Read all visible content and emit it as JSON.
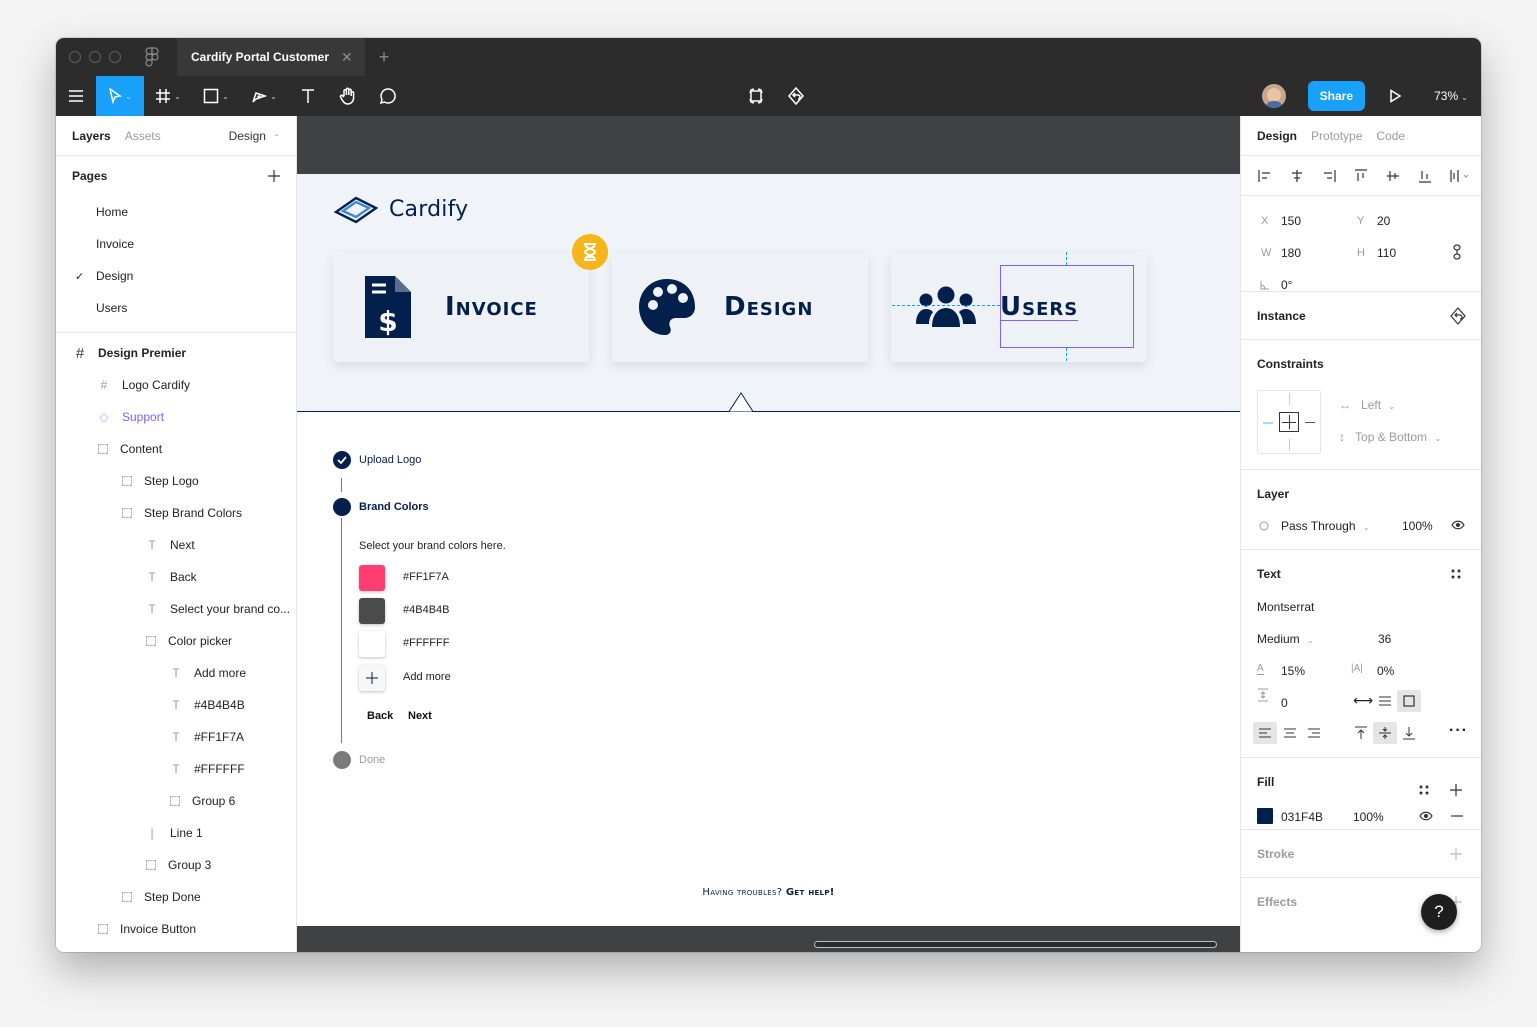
{
  "window": {
    "doc_title": "Cardify Portal Customer",
    "zoom": "73%",
    "share_label": "Share"
  },
  "left_panel": {
    "tabs": {
      "layers": "Layers",
      "assets": "Assets",
      "page_selector": "Design"
    },
    "pages_title": "Pages",
    "pages": [
      {
        "label": "Home",
        "checked": false
      },
      {
        "label": "Invoice",
        "checked": false
      },
      {
        "label": "Design",
        "checked": true
      },
      {
        "label": "Users",
        "checked": false
      }
    ],
    "layers": [
      {
        "label": "Design Premier",
        "indent": 0,
        "icon": "frame-icon",
        "bold": true
      },
      {
        "label": "Logo Cardify",
        "indent": 1,
        "icon": "frame-icon"
      },
      {
        "label": "Support",
        "indent": 1,
        "icon": "component-instance-icon",
        "purple": true
      },
      {
        "label": "Content",
        "indent": 1,
        "icon": "group-icon"
      },
      {
        "label": "Step Logo",
        "indent": 2,
        "icon": "group-icon"
      },
      {
        "label": "Step Brand Colors",
        "indent": 2,
        "icon": "group-icon"
      },
      {
        "label": "Next",
        "indent": 3,
        "icon": "text-icon"
      },
      {
        "label": "Back",
        "indent": 3,
        "icon": "text-icon"
      },
      {
        "label": "Select your brand co...",
        "indent": 3,
        "icon": "text-icon"
      },
      {
        "label": "Color picker",
        "indent": 3,
        "icon": "group-icon"
      },
      {
        "label": "Add more",
        "indent": 4,
        "icon": "text-icon"
      },
      {
        "label": "#4B4B4B",
        "indent": 4,
        "icon": "text-icon"
      },
      {
        "label": "#FF1F7A",
        "indent": 4,
        "icon": "text-icon"
      },
      {
        "label": "#FFFFFF",
        "indent": 4,
        "icon": "text-icon"
      },
      {
        "label": "Group 6",
        "indent": 4,
        "icon": "group-icon"
      },
      {
        "label": "Line 1",
        "indent": 3,
        "icon": "line-icon"
      },
      {
        "label": "Group 3",
        "indent": 3,
        "icon": "group-icon"
      },
      {
        "label": "Step Done",
        "indent": 2,
        "icon": "group-icon"
      },
      {
        "label": "Invoice Button",
        "indent": 1,
        "icon": "group-icon"
      }
    ]
  },
  "canvas": {
    "logo_text": "Cardify",
    "cards": [
      {
        "title": "Invoice",
        "icon": "invoice-icon"
      },
      {
        "title": "Design",
        "icon": "palette-icon"
      },
      {
        "title": "Users",
        "icon": "users-icon"
      }
    ],
    "steps": {
      "upload": "Upload Logo",
      "brand": "Brand Colors",
      "instruction": "Select your brand colors here.",
      "done": "Done"
    },
    "swatches": [
      {
        "hex": "#FF1F7A",
        "color": "#ff3d70"
      },
      {
        "hex": "#4B4B4B",
        "color": "#4b4b4b"
      },
      {
        "hex": "#FFFFFF",
        "color": "#ffffff"
      }
    ],
    "add_more": "Add more",
    "back": "Back",
    "next": "Next",
    "help_text": "Having troubles?",
    "help_link": "Get help!"
  },
  "right_panel": {
    "tabs": {
      "design": "Design",
      "prototype": "Prototype",
      "code": "Code"
    },
    "x_label": "X",
    "x": "150",
    "y_label": "Y",
    "y": "20",
    "w_label": "W",
    "w": "180",
    "h_label": "H",
    "h": "110",
    "rotation": "0°",
    "instance_title": "Instance",
    "constraints_title": "Constraints",
    "constraint_h": "Left",
    "constraint_v": "Top & Bottom",
    "layer_title": "Layer",
    "blend": "Pass Through",
    "layer_opacity": "100%",
    "text_title": "Text",
    "font_family": "Montserrat",
    "font_weight": "Medium",
    "font_size": "36",
    "line_height": "15%",
    "letter_spacing": "0%",
    "paragraph_spacing": "0",
    "fill_title": "Fill",
    "fill_hex": "031F4B",
    "fill_color": "#031f4b",
    "fill_opacity": "100%",
    "stroke_title": "Stroke",
    "effects_title": "Effects",
    "help_fab": "?"
  }
}
